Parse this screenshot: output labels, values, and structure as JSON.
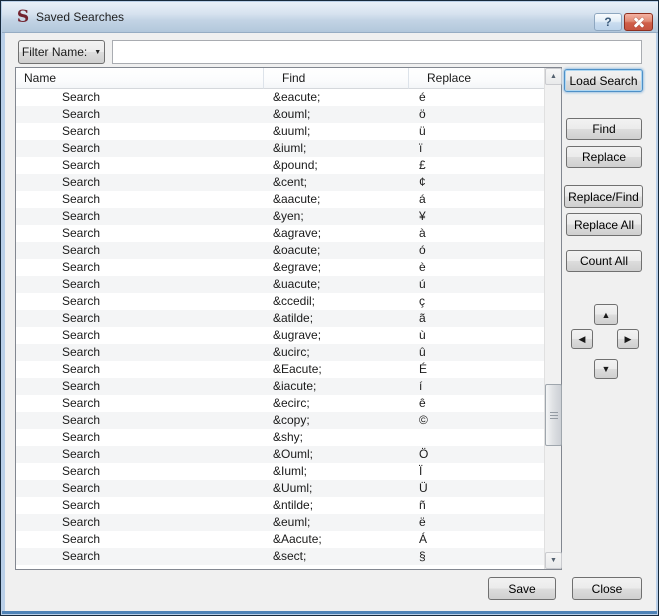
{
  "window": {
    "title": "Saved Searches",
    "icon_glyph": "S"
  },
  "titlebar": {
    "help_label": "?"
  },
  "filter": {
    "button_label": "Filter Name:",
    "input_value": ""
  },
  "table": {
    "columns": [
      "Name",
      "Find",
      "Replace"
    ],
    "rows": [
      {
        "name": "Search",
        "find": "&eacute;",
        "replace": "é"
      },
      {
        "name": "Search",
        "find": "&ouml;",
        "replace": "ö"
      },
      {
        "name": "Search",
        "find": "&uuml;",
        "replace": "ü"
      },
      {
        "name": "Search",
        "find": "&iuml;",
        "replace": "ï"
      },
      {
        "name": "Search",
        "find": "&pound;",
        "replace": "£"
      },
      {
        "name": "Search",
        "find": "&cent;",
        "replace": "¢"
      },
      {
        "name": "Search",
        "find": "&aacute;",
        "replace": "á"
      },
      {
        "name": "Search",
        "find": "&yen;",
        "replace": "¥"
      },
      {
        "name": "Search",
        "find": "&agrave;",
        "replace": "à"
      },
      {
        "name": "Search",
        "find": "&oacute;",
        "replace": "ó"
      },
      {
        "name": "Search",
        "find": "&egrave;",
        "replace": "è"
      },
      {
        "name": "Search",
        "find": "&uacute;",
        "replace": "ú"
      },
      {
        "name": "Search",
        "find": "&ccedil;",
        "replace": "ç"
      },
      {
        "name": "Search",
        "find": "&atilde;",
        "replace": "ã"
      },
      {
        "name": "Search",
        "find": "&ugrave;",
        "replace": "ù"
      },
      {
        "name": "Search",
        "find": "&ucirc;",
        "replace": "û"
      },
      {
        "name": "Search",
        "find": "&Eacute;",
        "replace": "É"
      },
      {
        "name": "Search",
        "find": "&iacute;",
        "replace": "í"
      },
      {
        "name": "Search",
        "find": "&ecirc;",
        "replace": "ê"
      },
      {
        "name": "Search",
        "find": "&copy;",
        "replace": "©"
      },
      {
        "name": "Search",
        "find": "&shy;",
        "replace": ""
      },
      {
        "name": "Search",
        "find": "&Ouml;",
        "replace": "Ö"
      },
      {
        "name": "Search",
        "find": "&Iuml;",
        "replace": "Ï"
      },
      {
        "name": "Search",
        "find": "&Uuml;",
        "replace": "Ü"
      },
      {
        "name": "Search",
        "find": "&ntilde;",
        "replace": "ñ"
      },
      {
        "name": "Search",
        "find": "&euml;",
        "replace": "ë"
      },
      {
        "name": "Search",
        "find": "&Aacute;",
        "replace": "Á"
      },
      {
        "name": "Search",
        "find": "&sect;",
        "replace": "§"
      }
    ]
  },
  "actions": {
    "load_search": "Load Search",
    "find": "Find",
    "replace": "Replace",
    "replace_find": "Replace/Find",
    "replace_all": "Replace All",
    "count_all": "Count All"
  },
  "icons": {
    "dropdown": "▼",
    "move_up": "▲",
    "move_down": "▼",
    "move_left": "◀",
    "move_right": "▶",
    "scroll_up": "▲",
    "scroll_down": "▼"
  },
  "footer": {
    "save": "Save",
    "close": "Close"
  },
  "colors": {
    "brand_maroon": "#72232f",
    "default_button_ring": "#4e90c7",
    "close_button_red": "#d05f49",
    "titlebar_top": "#e9f0f8",
    "titlebar_bottom": "#b2c7db",
    "dialog_background": "#f0f0f0"
  }
}
